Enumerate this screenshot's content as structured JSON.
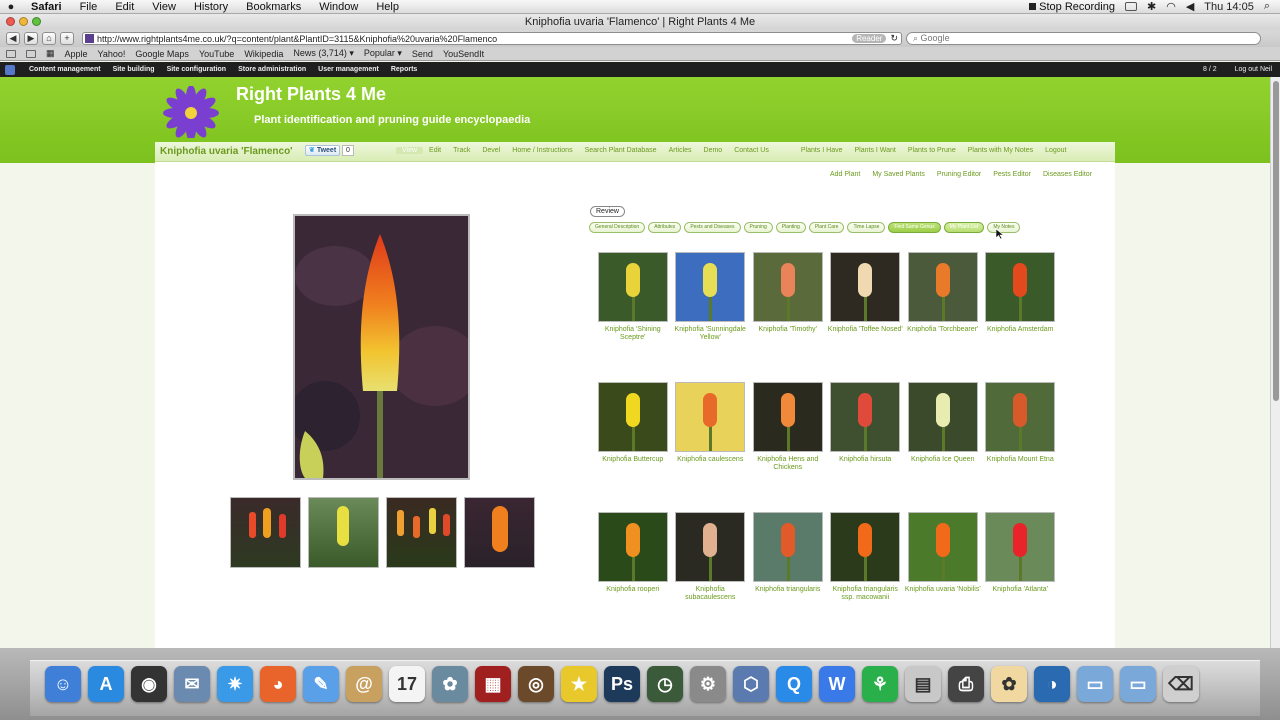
{
  "menubar": {
    "app": "Safari",
    "items": [
      "File",
      "Edit",
      "View",
      "History",
      "Bookmarks",
      "Window",
      "Help"
    ],
    "stop_recording": "Stop Recording",
    "clock": "Thu 14:05"
  },
  "window": {
    "title": "Kniphofia uvaria 'Flamenco' | Right Plants 4 Me",
    "url": "http://www.rightplants4me.co.uk/?q=content/plant&PlantID=3115&Kniphofia%20uvaria%20Flamenco",
    "reader": "Reader",
    "search_placeholder": "Google"
  },
  "bookmarks": [
    "Apple",
    "Yahoo!",
    "Google Maps",
    "YouTube",
    "Wikipedia",
    "News (3,714) ▾",
    "Popular ▾",
    "Send",
    "YouSendIt"
  ],
  "admin": {
    "items": [
      "Content management",
      "Site building",
      "Site configuration",
      "Store administration",
      "User management",
      "Reports"
    ],
    "count": "8 / 2",
    "logout": "Log out Neil"
  },
  "site": {
    "title": "Right Plants 4 Me",
    "slogan": "Plant identification and pruning guide encyclopaedia"
  },
  "node": {
    "title": "Kniphofia uvaria 'Flamenco'",
    "tweet": "Tweet",
    "tweet_count": "0"
  },
  "nav": [
    "View",
    "Edit",
    "Track",
    "Devel",
    "Home / Instructions",
    "Search Plant Database",
    "Articles",
    "Demo",
    "Contact Us"
  ],
  "nav_user": [
    "Plants I Have",
    "Plants I Want",
    "Plants to Prune",
    "Plants with My Notes",
    "Logout"
  ],
  "subnav": [
    "Add Plant",
    "My Saved Plants",
    "Pruning Editor",
    "Pests Editor",
    "Diseases Editor"
  ],
  "review": "Review",
  "tabs": [
    "General Description",
    "Attributes",
    "Pests and Diseases",
    "Pruning",
    "Planting",
    "Plant Care",
    "Time Lapse",
    "Find Same Genus",
    "My Plant List",
    "My Notes"
  ],
  "colors": {
    "header_green": "#86c926",
    "link_green": "#6a9a1c"
  },
  "plants": [
    {
      "name": "Kniphofia 'Shining Sceptre'",
      "c1": "#e8d33a",
      "c2": "#3b5a2a"
    },
    {
      "name": "Kniphofia 'Sunningdale Yellow'",
      "c1": "#e6de54",
      "c2": "#3d6dbf"
    },
    {
      "name": "Kniphofia 'Timothy'",
      "c1": "#e9845a",
      "c2": "#5a6a3a"
    },
    {
      "name": "Kniphofia 'Toffee Nosed'",
      "c1": "#f0d8b0",
      "c2": "#2e2a22"
    },
    {
      "name": "Kniphofia 'Torchbearer'",
      "c1": "#e87a2a",
      "c2": "#4a5a3a"
    },
    {
      "name": "Kniphofia Amsterdam",
      "c1": "#e24a1e",
      "c2": "#3a5a2a"
    },
    {
      "name": "Kniphofia Buttercup",
      "c1": "#f0d820",
      "c2": "#3a4a1a"
    },
    {
      "name": "Kniphofia caulescens",
      "c1": "#e86a2a",
      "c2": "#e8d25a"
    },
    {
      "name": "Kniphofia Hens and Chickens",
      "c1": "#f08a3a",
      "c2": "#2a2a1e"
    },
    {
      "name": "Kniphofia hirsuta",
      "c1": "#e04a3a",
      "c2": "#3e5030"
    },
    {
      "name": "Kniphofia Ice Queen",
      "c1": "#e8ecb0",
      "c2": "#3a4a2a"
    },
    {
      "name": "Kniphofia Mount Etna",
      "c1": "#d85a2a",
      "c2": "#506a3a"
    },
    {
      "name": "Kniphofia rooperi",
      "c1": "#f09020",
      "c2": "#2a4a1a"
    },
    {
      "name": "Kniphofia subacaulescens",
      "c1": "#e0b090",
      "c2": "#2a2a22"
    },
    {
      "name": "Kniphofia triangularis",
      "c1": "#e05a2a",
      "c2": "#5a7a6a"
    },
    {
      "name": "Kniphofia triangularis ssp. macowanii",
      "c1": "#f06a1a",
      "c2": "#2a3a1a"
    },
    {
      "name": "Kniphofia uvaria 'Nobilis'",
      "c1": "#f06a1a",
      "c2": "#4a7a2a"
    },
    {
      "name": "Kniphofia 'Atlanta'",
      "c1": "#e8242a",
      "c2": "#6a8a5a"
    }
  ],
  "dock": [
    {
      "icon": "finder-icon",
      "color": "#3f7fd8",
      "glyph": "☺"
    },
    {
      "icon": "app-store-icon",
      "color": "#2a8ae0",
      "glyph": "A"
    },
    {
      "icon": "dashboard-icon",
      "color": "#333333",
      "glyph": "◉"
    },
    {
      "icon": "mail-icon",
      "color": "#6a8ab0",
      "glyph": "✉"
    },
    {
      "icon": "safari-icon",
      "color": "#3a9ae8",
      "glyph": "✷"
    },
    {
      "icon": "firefox-icon",
      "color": "#e8642a",
      "glyph": "◕"
    },
    {
      "icon": "ichat-icon",
      "color": "#5aa0e8",
      "glyph": "✎"
    },
    {
      "icon": "address-book-icon",
      "color": "#c8a060",
      "glyph": "@"
    },
    {
      "icon": "ical-icon",
      "color": "#f4f4f4",
      "glyph": "17"
    },
    {
      "icon": "iphoto-icon",
      "color": "#6a8aa0",
      "glyph": "✿"
    },
    {
      "icon": "photo-booth-icon",
      "color": "#a02020",
      "glyph": "▦"
    },
    {
      "icon": "aperture-icon",
      "color": "#6a4a2a",
      "glyph": "◎"
    },
    {
      "icon": "imovie-icon",
      "color": "#e8c82a",
      "glyph": "★"
    },
    {
      "icon": "photoshop-icon",
      "color": "#1e3a5a",
      "glyph": "Ps"
    },
    {
      "icon": "time-machine-icon",
      "color": "#3a5a3a",
      "glyph": "◷"
    },
    {
      "icon": "system-preferences-icon",
      "color": "#8a8a8a",
      "glyph": "⚙"
    },
    {
      "icon": "xcode-icon",
      "color": "#5a7ab0",
      "glyph": "⬡"
    },
    {
      "icon": "quicktime-icon",
      "color": "#2a8ae8",
      "glyph": "Q"
    },
    {
      "icon": "textwrangler-icon",
      "color": "#3a7ae8",
      "glyph": "W"
    },
    {
      "icon": "growl-icon",
      "color": "#2ab04a",
      "glyph": "⚘"
    },
    {
      "icon": "preview-icon",
      "color": "#c8c8c8",
      "glyph": "▤"
    },
    {
      "icon": "printer-icon",
      "color": "#444444",
      "glyph": "⎙"
    },
    {
      "icon": "art-icon",
      "color": "#f0d8a0",
      "glyph": "✿"
    },
    {
      "icon": "screen-sharing-icon",
      "color": "#2a6ab0",
      "glyph": "◑"
    },
    {
      "icon": "applications-folder-icon",
      "color": "#7aa8d8",
      "glyph": "▭"
    },
    {
      "icon": "documents-folder-icon",
      "color": "#7aa8d8",
      "glyph": "▭"
    },
    {
      "icon": "trash-icon",
      "color": "#cfcfcf",
      "glyph": "⌫"
    }
  ]
}
